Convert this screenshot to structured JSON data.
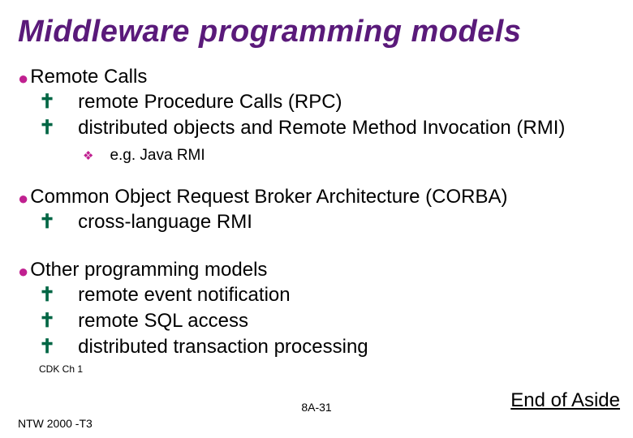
{
  "title": "Middleware programming models",
  "sections": [
    {
      "heading": "Remote Calls",
      "items": [
        {
          "text": "remote Procedure Calls (RPC)"
        },
        {
          "text": "distributed objects and Remote Method Invocation (RMI)",
          "sub": [
            {
              "text": "e.g. Java RMI"
            }
          ]
        }
      ]
    },
    {
      "heading": "Common Object Request Broker Architecture (CORBA)",
      "items": [
        {
          "text": "cross-language RMI"
        }
      ]
    },
    {
      "heading": "Other programming models",
      "items": [
        {
          "text": "remote event notification"
        },
        {
          "text": "remote SQL access"
        },
        {
          "text": "distributed transaction processing"
        }
      ]
    }
  ],
  "footnote": "CDK Ch 1",
  "footer_left": "NTW 2000 -T3",
  "footer_center": "8A-31",
  "aside": "End of Aside"
}
